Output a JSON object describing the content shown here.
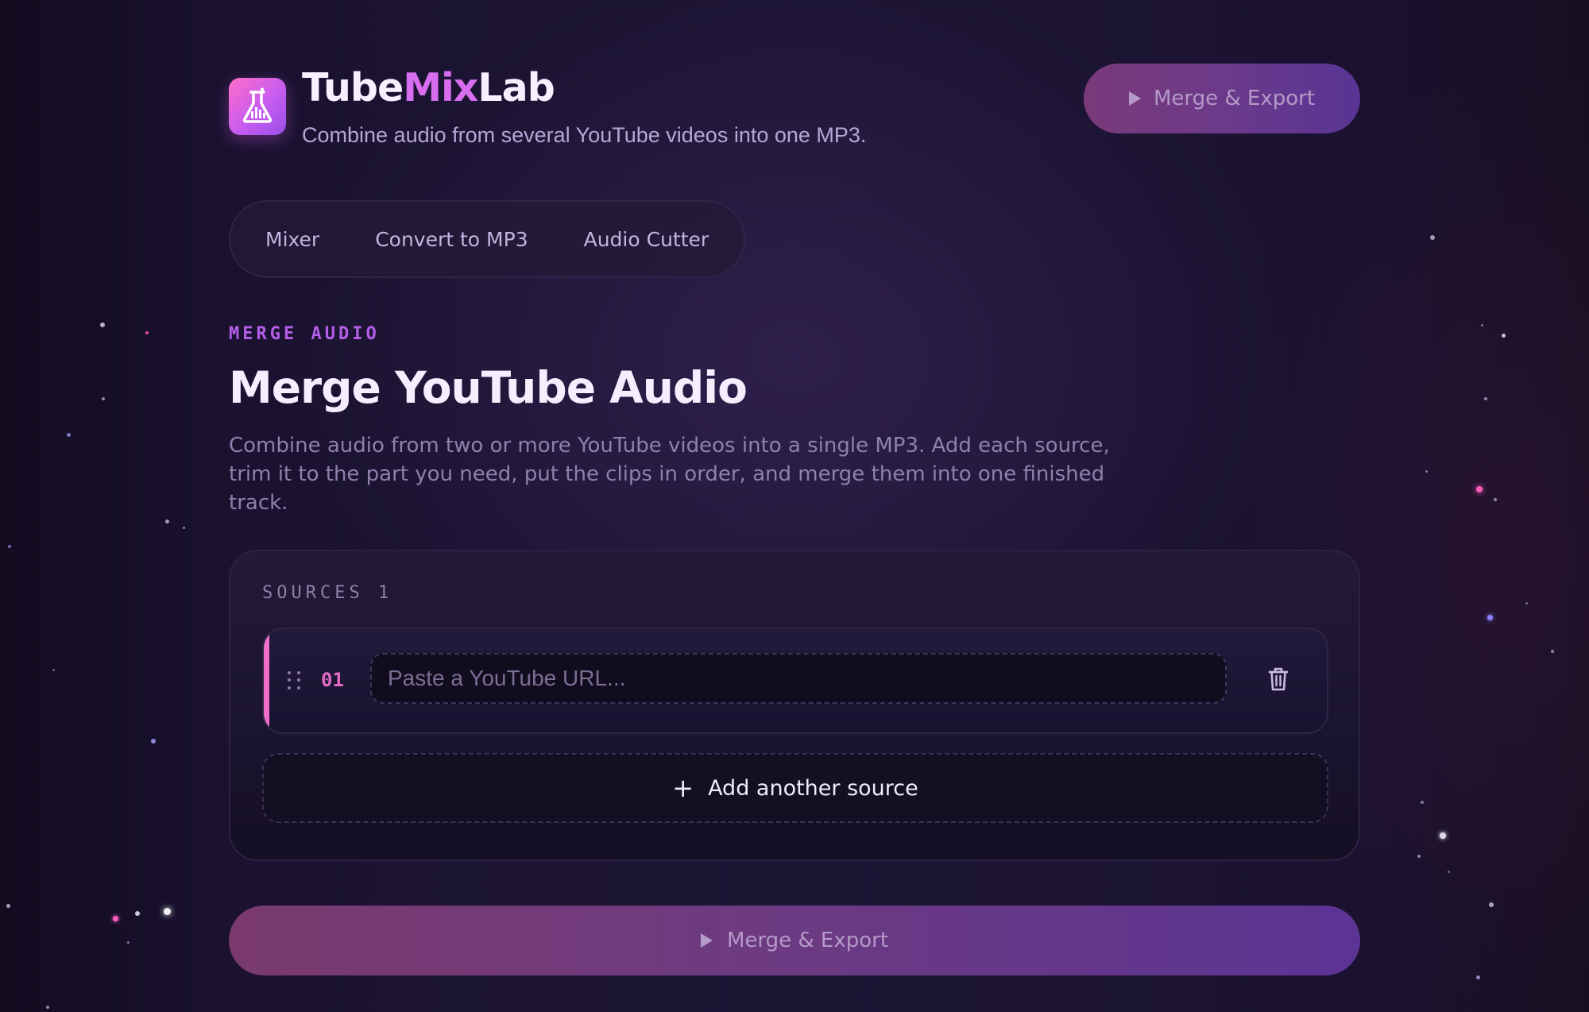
{
  "brand": {
    "name_part1": "Tube",
    "name_part2": "Mix",
    "name_part3": "Lab",
    "tagline": "Combine audio from several YouTube videos into one MP3."
  },
  "header": {
    "export_label": "Merge & Export"
  },
  "tabs": [
    {
      "label": "Mixer"
    },
    {
      "label": "Convert to MP3"
    },
    {
      "label": "Audio Cutter"
    }
  ],
  "hero": {
    "eyebrow": "MERGE AUDIO",
    "title": "Merge YouTube Audio",
    "description": "Combine audio from two or more YouTube videos into a single MP3. Add each source, trim it to the part you need, put the clips in order, and merge them into one finished track."
  },
  "sources": {
    "label": "SOURCES 1",
    "items": [
      {
        "number": "01",
        "url_value": "",
        "url_placeholder": "Paste a YouTube URL..."
      }
    ],
    "add_label": "Add another source",
    "add_icon": "+"
  },
  "footer": {
    "export_label": "Merge & Export"
  },
  "colors": {
    "accent_pink": "#f06ec8",
    "accent_purple": "#b45ee8",
    "background": "#160f25"
  },
  "icons": [
    "logo-icon",
    "play-icon",
    "drag-handle-icon",
    "trash-icon",
    "plus-icon"
  ]
}
